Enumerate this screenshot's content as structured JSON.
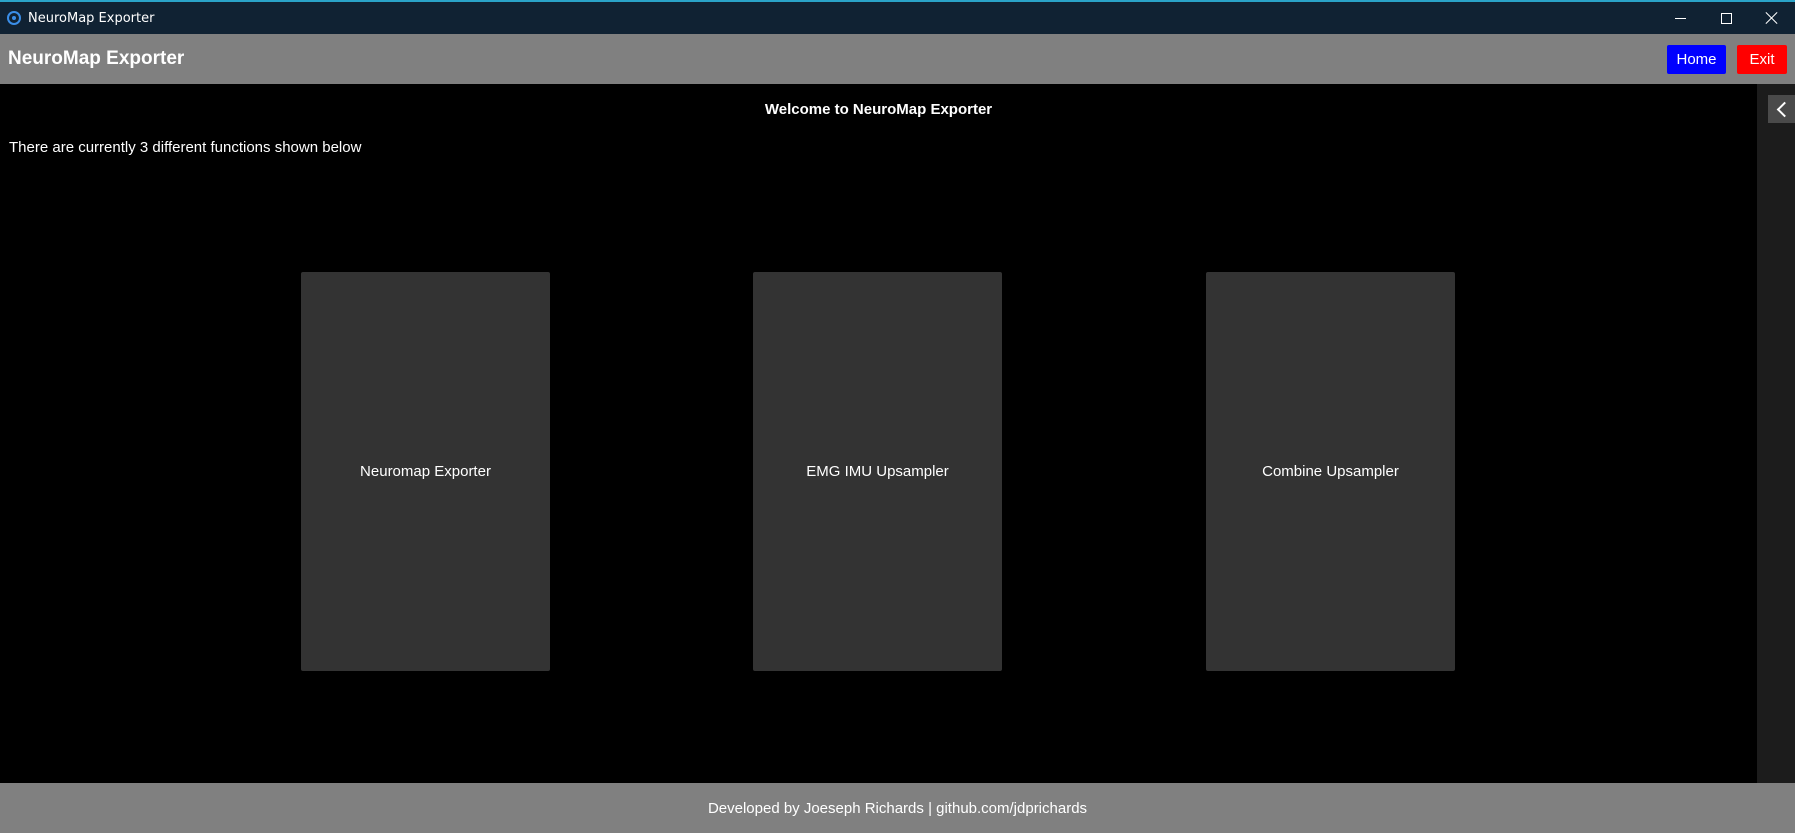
{
  "window": {
    "title": "NeuroMap Exporter",
    "icon": "app-icon"
  },
  "header": {
    "app_name": "NeuroMap Exporter",
    "home_label": "Home",
    "exit_label": "Exit",
    "colors": {
      "home": "#0000ff",
      "exit": "#ff0000",
      "bar": "#808080"
    }
  },
  "main": {
    "welcome": "Welcome to NeuroMap Exporter",
    "subtitle": "There are currently 3 different functions shown below",
    "cards": [
      {
        "label": "Neuromap Exporter"
      },
      {
        "label": "EMG IMU Upsampler"
      },
      {
        "label": "Combine Upsampler"
      }
    ]
  },
  "sidebar": {
    "toggle_icon": "chevron-left-icon"
  },
  "footer": {
    "text": "Developed by Joeseph Richards | github.com/jdprichards"
  }
}
